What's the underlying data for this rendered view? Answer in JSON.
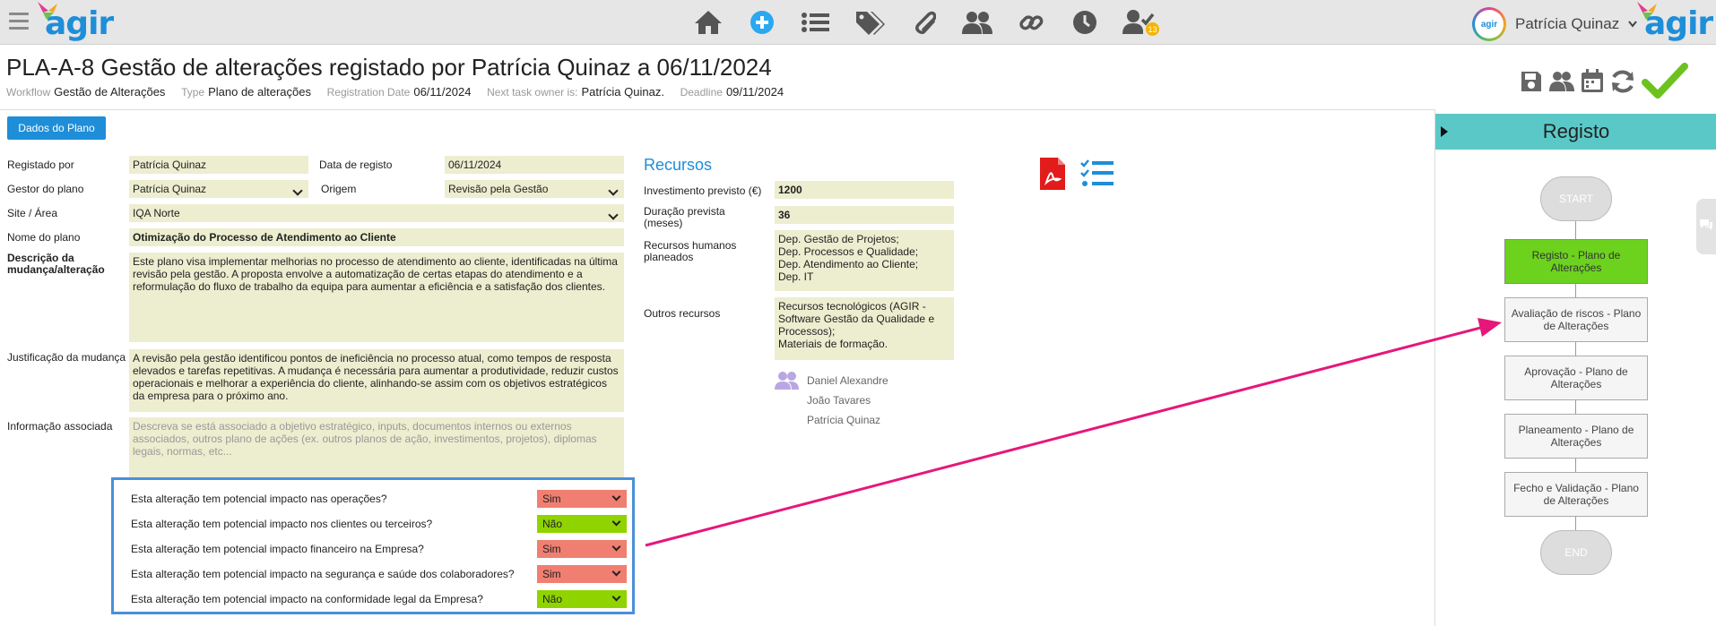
{
  "topbar": {
    "logo_text": "agir",
    "nav_icons": [
      "home-icon",
      "add-icon",
      "list-icon",
      "tags-icon",
      "attachment-icon",
      "users-icon",
      "link-icon",
      "clock-icon",
      "user-check-icon"
    ],
    "notification_count": "13",
    "user_name": "Patrícia Quinaz",
    "avatar_text": "agir"
  },
  "header": {
    "title": "PLA-A-8 Gestão de alterações registado por Patrícia Quinaz a 06/11/2024",
    "meta": [
      {
        "key": "Workflow",
        "value": "Gestão de Alterações"
      },
      {
        "key": "Type",
        "value": "Plano de alterações"
      },
      {
        "key": "Registration Date",
        "value": "06/11/2024"
      },
      {
        "key": "Next task owner is:",
        "value": "Patrícia Quinaz."
      },
      {
        "key": "Deadline",
        "value": "09/11/2024"
      }
    ]
  },
  "tab": {
    "label": "Dados do Plano"
  },
  "form": {
    "registado_por_label": "Registado por",
    "registado_por": "Patrícia Quinaz",
    "data_registo_label": "Data de registo",
    "data_registo": "06/11/2024",
    "gestor_label": "Gestor do plano",
    "gestor": "Patrícia Quinaz",
    "origem_label": "Origem",
    "origem": "Revisão pela Gestão",
    "site_label": "Site / Área",
    "site": "IQA Norte",
    "nome_label": "Nome do plano",
    "nome": "Otimização do Processo de Atendimento ao Cliente",
    "descricao_label": "Descrição da mudança/alteração",
    "descricao": "Este plano visa implementar melhorias no processo de atendimento ao cliente, identificadas na última revisão pela gestão. A proposta envolve a automatização de certas etapas do atendimento e a reformulação do fluxo de trabalho da equipa para aumentar a eficiência e a satisfação dos clientes.",
    "justificacao_label": "Justificação da mudança",
    "justificacao": "A revisão pela gestão identificou pontos de ineficiência no processo atual, como tempos de resposta elevados e tarefas repetitivas. A mudança é necessária para aumentar a produtividade, reduzir custos operacionais e melhorar a experiência do cliente, alinhando-se assim com os objetivos estratégicos da empresa para o próximo ano.",
    "info_label": "Informação associada",
    "info_placeholder": "Descreva se está associado a objetivo estratégico, inputs, documentos internos ou externos associados, outros plano de ações (ex. outros planos de ação, investimentos, projetos), diplomas legais, normas, etc..."
  },
  "recursos": {
    "title": "Recursos",
    "investimento_label": "Investimento previsto (€)",
    "investimento": "1200",
    "duracao_label": "Duração prevista (meses)",
    "duracao": "36",
    "rh_label": "Recursos humanos planeados",
    "rh": "Dep. Gestão de Projetos;\nDep. Processos e Qualidade;\nDep. Atendimento ao Cliente;\nDep. IT",
    "outros_label": "Outros recursos",
    "outros": "Recursos tecnológicos (AGIR - Software Gestão da Qualidade e Processos);\nMateriais de formação.",
    "people": [
      "Daniel Alexandre",
      "João Tavares",
      "Patrícia Quinaz"
    ]
  },
  "impacts": [
    {
      "question": "Esta alteração tem potencial impacto nas operações?",
      "answer": "Sim"
    },
    {
      "question": "Esta alteração tem potencial impacto nos clientes ou terceiros?",
      "answer": "Não"
    },
    {
      "question": "Esta alteração tem potencial impacto financeiro na Empresa?",
      "answer": "Sim"
    },
    {
      "question": "Esta alteração tem potencial impacto na segurança e saúde dos colaboradores?",
      "answer": "Sim"
    },
    {
      "question": "Esta alteração tem potencial impacto na conformidade legal da Empresa?",
      "answer": "Não"
    }
  ],
  "workflow": {
    "title": "Registo",
    "start": "START",
    "end": "END",
    "steps": [
      "Registo - Plano de Alterações",
      "Avaliação de riscos - Plano de Alterações",
      "Aprovação - Plano de Alterações",
      "Planeamento - Plano de Alterações",
      "Fecho e Validação - Plano de Alterações"
    ],
    "active_step_index": 0
  },
  "colors": {
    "accent": "#1e8ed8",
    "sim": "#f07f72",
    "nao": "#8fd400",
    "active_step": "#6cd21e",
    "arrow": "#e6177a"
  }
}
